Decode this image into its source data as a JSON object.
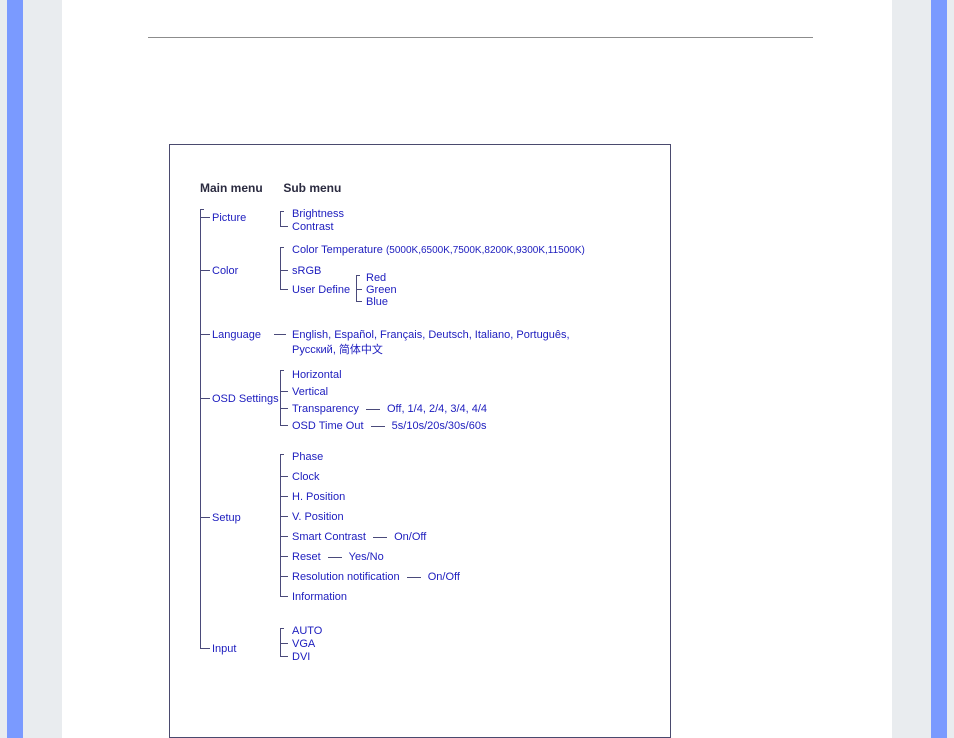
{
  "headers": {
    "main": "Main menu",
    "sub": "Sub menu"
  },
  "sections": {
    "picture": {
      "label": "Picture",
      "items": [
        "Brightness",
        "Contrast"
      ]
    },
    "color": {
      "label": "Color",
      "color_temp_label": "Color Temperature",
      "color_temp_values": "(5000K,6500K,7500K,8200K,9300K,11500K)",
      "srgb": "sRGB",
      "user_define": {
        "label": "User Define",
        "items": [
          "Red",
          "Green",
          "Blue"
        ]
      }
    },
    "language": {
      "label": "Language",
      "value": "English, Español, Français, Deutsch, Italiano, Português, Русский, 简体中文"
    },
    "osd": {
      "label": "OSD Settings",
      "horizontal": "Horizontal",
      "vertical": "Vertical",
      "transparency": {
        "label": "Transparency",
        "values": "Off, 1/4, 2/4, 3/4, 4/4"
      },
      "timeout": {
        "label": "OSD Time Out",
        "values": "5s/10s/20s/30s/60s"
      }
    },
    "setup": {
      "label": "Setup",
      "phase": "Phase",
      "clock": "Clock",
      "hpos": "H. Position",
      "vpos": "V. Position",
      "smart_contrast": {
        "label": "Smart Contrast",
        "values": "On/Off"
      },
      "reset": {
        "label": "Reset",
        "values": "Yes/No"
      },
      "res_notif": {
        "label": "Resolution notification",
        "values": "On/Off"
      },
      "info": "Information"
    },
    "input": {
      "label": "Input",
      "items": [
        "AUTO",
        "VGA",
        "DVI"
      ]
    }
  }
}
